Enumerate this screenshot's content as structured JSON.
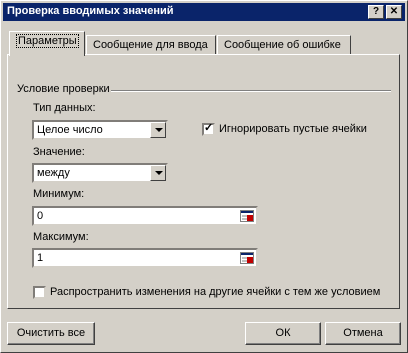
{
  "window": {
    "title": "Проверка вводимых значений",
    "help_button": "?",
    "close_button": "✕"
  },
  "tabs": [
    {
      "label": "Параметры"
    },
    {
      "label": "Сообщение для ввода"
    },
    {
      "label": "Сообщение об ошибке"
    }
  ],
  "validation": {
    "group_title": "Условие проверки",
    "data_type_label": "Тип данных:",
    "data_type_value": "Целое число",
    "ignore_blank_label": "Игнорировать пустые ячейки",
    "ignore_blank_checked": true,
    "operator_label": "Значение:",
    "operator_value": "между",
    "minimum_label": "Минимум:",
    "minimum_value": "0",
    "maximum_label": "Максимум:",
    "maximum_value": "1",
    "apply_all_label": "Распространить изменения на другие ячейки с тем же условием",
    "apply_all_checked": false
  },
  "buttons": {
    "clear_all": "Очистить все",
    "ok": "ОК",
    "cancel": "Отмена"
  },
  "colors": {
    "titlebar": "#0a246a",
    "face": "#d4d0c8"
  }
}
